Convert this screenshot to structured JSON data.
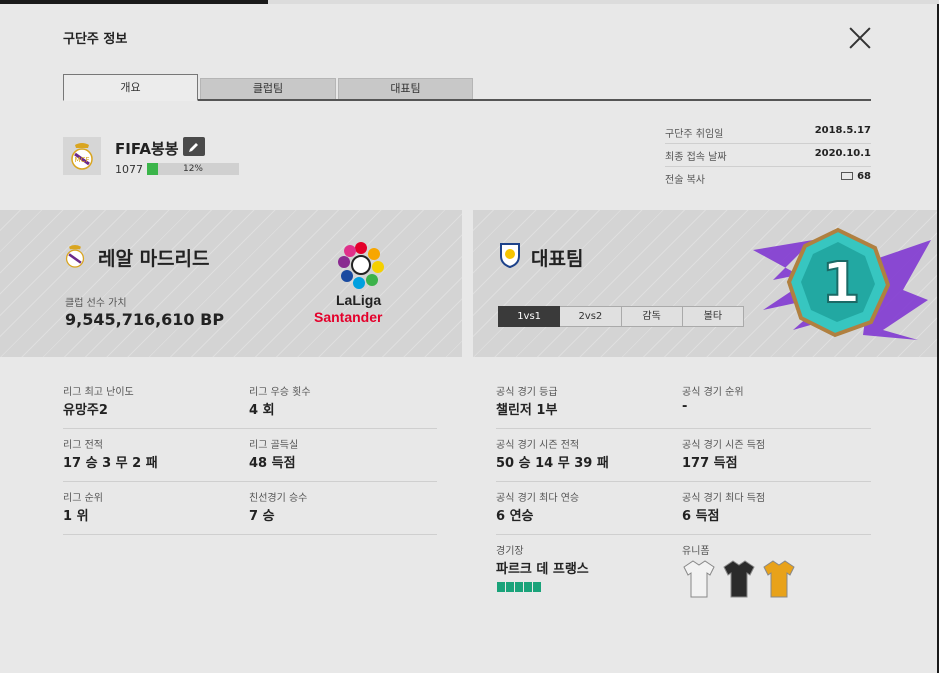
{
  "window": {
    "title": "구단주 정보",
    "close_icon": "close-icon"
  },
  "tabs": [
    {
      "label": "개요",
      "active": true
    },
    {
      "label": "클럽팀",
      "active": false
    },
    {
      "label": "대표팀",
      "active": false
    }
  ],
  "profile": {
    "nickname": "FIFA봉봉",
    "level": "1077",
    "xp_percent_label": "12%",
    "xp_fraction": 0.12,
    "edit_icon": "pencil-icon",
    "crest_icon": "real-madrid-crest-icon"
  },
  "meta": [
    {
      "label": "구단주 취임일",
      "value": "2018.5.17"
    },
    {
      "label": "최종 접속 날짜",
      "value": "2020.10.1"
    },
    {
      "label": "전술 복사",
      "value": "68",
      "icon": "tactic-copy-icon"
    }
  ],
  "club": {
    "name": "레알 마드리드",
    "value_label": "클럽 선수 가치",
    "value": "9,545,716,610 BP",
    "league_logo": {
      "word1": "LaLiga",
      "word2": "Santander"
    }
  },
  "national": {
    "title": "대표팀",
    "subtabs": [
      {
        "label": "1vs1",
        "active": true
      },
      {
        "label": "2vs2",
        "active": false
      },
      {
        "label": "감독",
        "active": false
      },
      {
        "label": "볼타",
        "active": false
      }
    ],
    "rank_badge_number": "1"
  },
  "club_stats": [
    {
      "label": "리그 최고 난이도",
      "value": "유망주2"
    },
    {
      "label": "리그 우승 횟수",
      "value": "4 회"
    },
    {
      "label": "리그 전적",
      "value": "17 승 3 무 2 패"
    },
    {
      "label": "리그 골득실",
      "value": "48 득점"
    },
    {
      "label": "리그 순위",
      "value": "1 위"
    },
    {
      "label": "친선경기 승수",
      "value": "7 승"
    }
  ],
  "national_stats": [
    {
      "label": "공식 경기 등급",
      "value": "챌린저 1부"
    },
    {
      "label": "공식 경기 순위",
      "value": "-"
    },
    {
      "label": "공식 경기 시즌 전적",
      "value": "50 승 14 무 39 패"
    },
    {
      "label": "공식 경기 시즌 득점",
      "value": "177 득점"
    },
    {
      "label": "공식 경기 최다 연승",
      "value": "6 연승"
    },
    {
      "label": "공식 경기 최다 득점",
      "value": "6 득점"
    },
    {
      "label": "경기장",
      "value": "파르크 데 프랭스"
    },
    {
      "label": "유니폼",
      "value": ""
    }
  ],
  "stadium_stars": 5,
  "jerseys": [
    {
      "name": "white-jersey-icon",
      "color": "#f2f2f2"
    },
    {
      "name": "black-jersey-icon",
      "color": "#2b2b2b"
    },
    {
      "name": "orange-jersey-icon",
      "color": "#e8a21a"
    }
  ],
  "colors": {
    "accent_green": "#3bb54a",
    "badge_teal": "#37c6c0",
    "badge_purple": "#7b2fd1",
    "laliga_red": "#e4002b"
  }
}
